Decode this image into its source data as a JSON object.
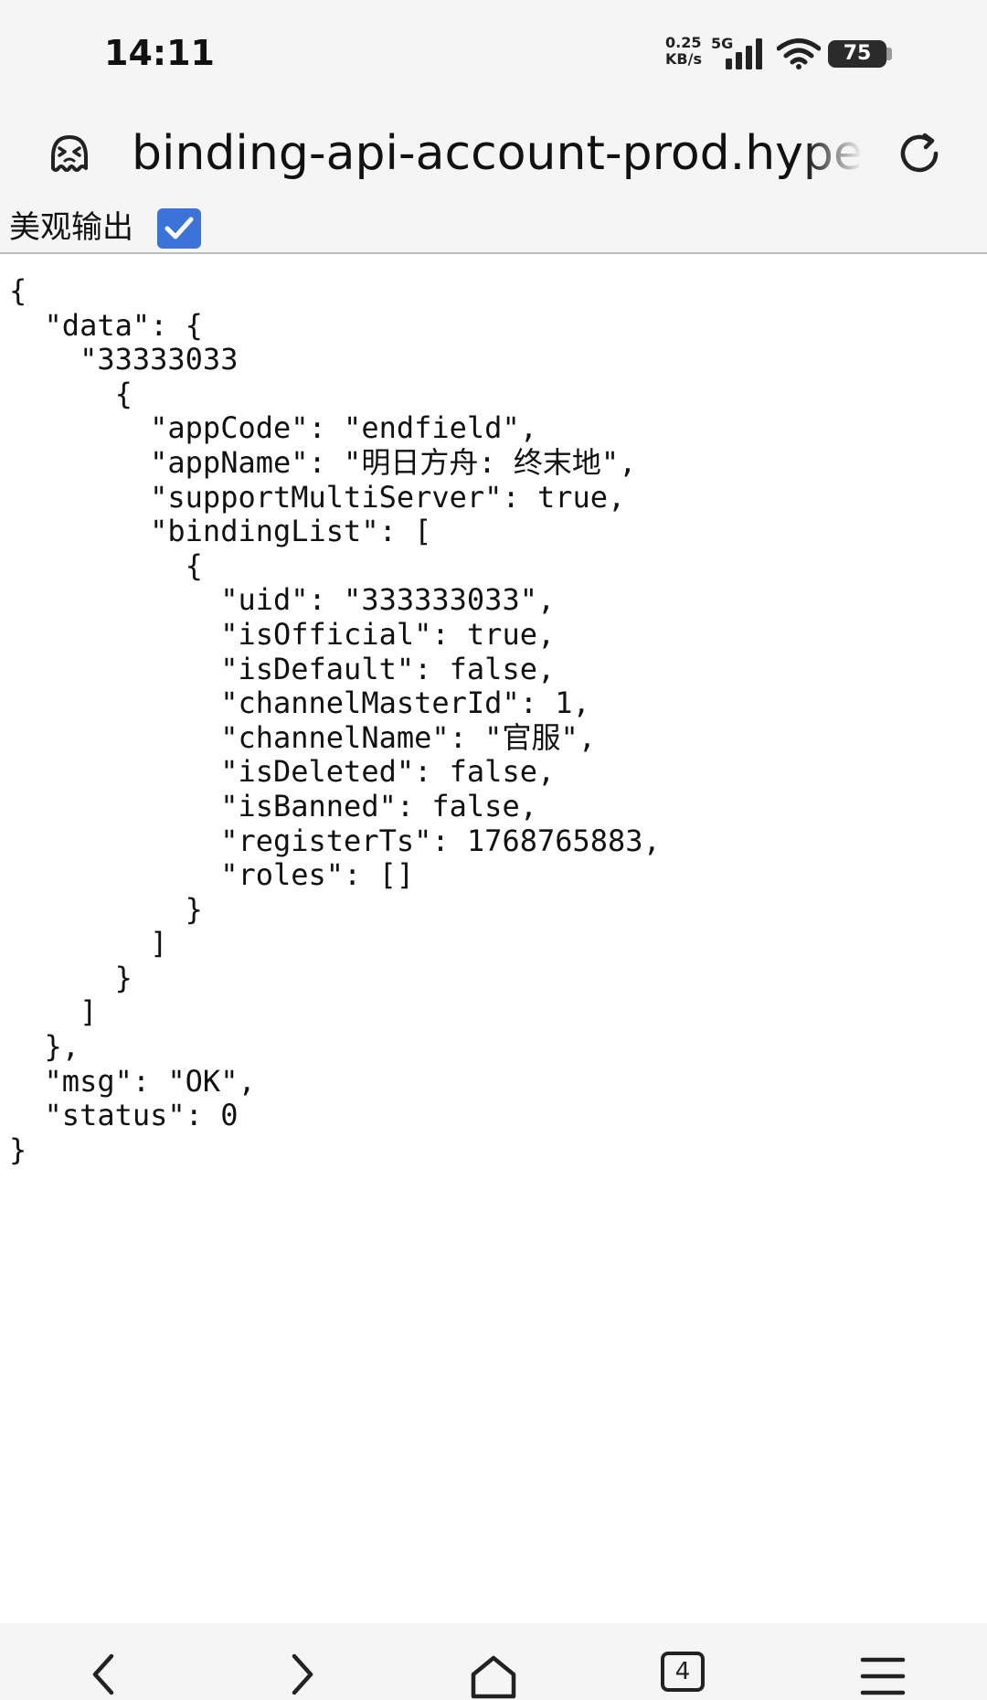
{
  "status_bar": {
    "time": "14:11",
    "net_speed": "0.25 KB/s",
    "net_type": "5G",
    "battery": "75"
  },
  "address_bar": {
    "url": "binding-api-account-prod.hyper"
  },
  "pretty_print": {
    "label": "美观输出",
    "checked": true
  },
  "json_lines": [
    "{",
    "  \"data\": {",
    "    \"33333033",
    "      {",
    "        \"appCode\": \"endfield\",",
    "        \"appName\": \"明日方舟: 终末地\",",
    "        \"supportMultiServer\": true,",
    "        \"bindingList\": [",
    "          {",
    "            \"uid\": \"333333033\",",
    "            \"isOfficial\": true,",
    "            \"isDefault\": false,",
    "            \"channelMasterId\": 1,",
    "            \"channelName\": \"官服\",",
    "            \"isDeleted\": false,",
    "            \"isBanned\": false,",
    "            \"registerTs\": 1768765883,",
    "            \"roles\": []",
    "          }",
    "        ]",
    "      }",
    "    ]",
    "  },",
    "  \"msg\": \"OK\",",
    "  \"status\": 0",
    "}"
  ],
  "bottom_nav": {
    "tab_count": "4"
  },
  "icons": {
    "site": "ghost-face-icon",
    "reload": "reload-icon",
    "checkbox": "checkmark-icon",
    "back": "chevron-left-icon",
    "forward": "chevron-right-icon",
    "home": "home-icon",
    "tabs": "tabs-icon",
    "menu": "hamburger-menu-icon"
  },
  "colors": {
    "checkbox": "#3b73d9",
    "chrome_background": "#f5f5f5",
    "text": "#111111"
  }
}
